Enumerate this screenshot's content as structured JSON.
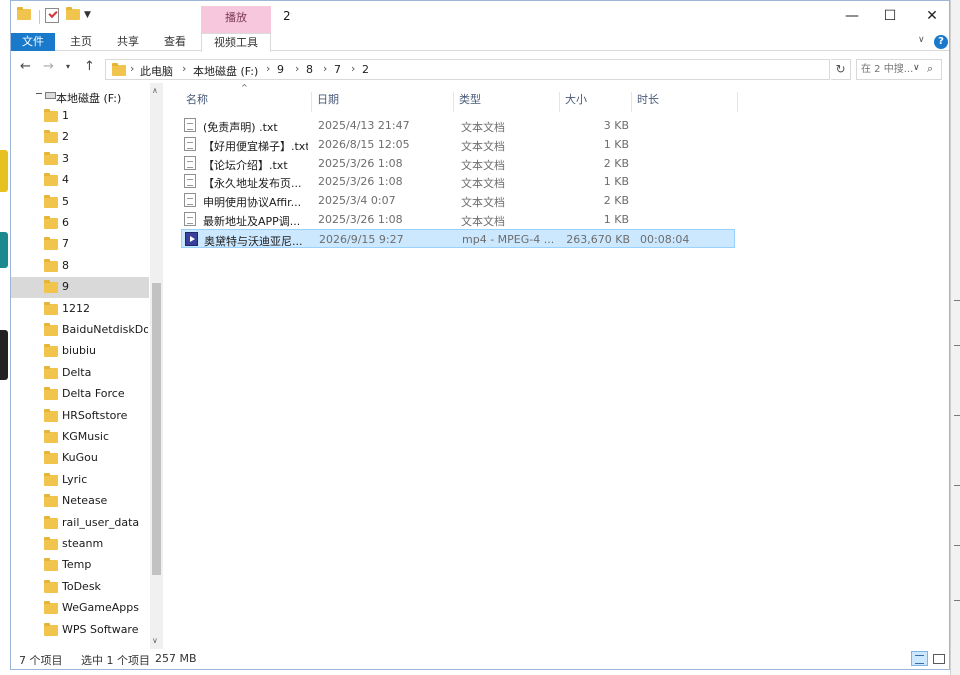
{
  "window": {
    "title": "2",
    "contextual_tab_group": "播放",
    "controls": {
      "minimize": "—",
      "maximize": "☐",
      "close": "✕"
    }
  },
  "ribbon": {
    "tabs": [
      "文件",
      "主页",
      "共享",
      "查看",
      "视频工具"
    ],
    "file_tab_color": "#1979ca",
    "context_color": "#f7c8dd"
  },
  "address": {
    "breadcrumb": [
      "此电脑",
      "本地磁盘 (F:)",
      "9",
      "8",
      "7",
      "2"
    ],
    "search_placeholder": "在 2 中搜..."
  },
  "navpane": {
    "drive": "本地磁盘 (F:)",
    "folders": [
      "1",
      "2",
      "3",
      "4",
      "5",
      "6",
      "7",
      "8",
      "9",
      "1212",
      "BaiduNetdiskDow",
      "biubiu",
      "Delta",
      "Delta Force",
      "HRSoftstore",
      "KGMusic",
      "KuGou",
      "Lyric",
      "Netease",
      "rail_user_data",
      "steanm",
      "Temp",
      "ToDesk",
      "WeGameApps",
      "WPS Software"
    ],
    "selected_folder": "9"
  },
  "file_list": {
    "columns": [
      "名称",
      "日期",
      "类型",
      "大小",
      "时长"
    ],
    "rows": [
      {
        "name": "(免责声明) .txt",
        "date": "2025/4/13 21:47",
        "type": "文本文档",
        "size": "3 KB",
        "duration": "",
        "icon": "text-file-icon"
      },
      {
        "name": "【好用便宜梯子】.txt",
        "date": "2026/8/15 12:05",
        "type": "文本文档",
        "size": "1 KB",
        "duration": "",
        "icon": "text-file-icon"
      },
      {
        "name": "【论坛介绍】.txt",
        "date": "2025/3/26 1:08",
        "type": "文本文档",
        "size": "2 KB",
        "duration": "",
        "icon": "text-file-icon"
      },
      {
        "name": "【永久地址发布页...",
        "date": "2025/3/26 1:08",
        "type": "文本文档",
        "size": "1 KB",
        "duration": "",
        "icon": "text-file-icon"
      },
      {
        "name": "申明使用协议Affir...",
        "date": "2025/3/4 0:07",
        "type": "文本文档",
        "size": "2 KB",
        "duration": "",
        "icon": "text-file-icon"
      },
      {
        "name": "最新地址及APP调...",
        "date": "2025/3/26 1:08",
        "type": "文本文档",
        "size": "1 KB",
        "duration": "",
        "icon": "text-file-icon"
      },
      {
        "name": "奥黛特与沃迪亚尼...",
        "date": "2026/9/15 9:27",
        "type": "mp4 - MPEG-4 ...",
        "size": "263,670 KB",
        "duration": "00:08:04",
        "icon": "video-file-icon",
        "selected": true
      }
    ]
  },
  "statusbar": {
    "item_count": "7 个项目",
    "selection": "选中 1 个项目",
    "selection_size": "257 MB"
  }
}
